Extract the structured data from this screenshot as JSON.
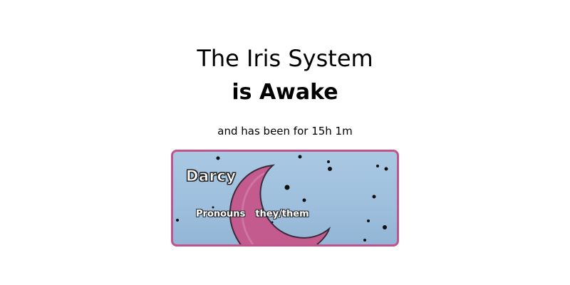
{
  "status": {
    "title_line1": "The Iris System",
    "title_line2": "is Awake",
    "subtitle": "and has been for 15h 1m"
  },
  "member_card": {
    "name": "Darcy",
    "pronouns_label": "Pronouns",
    "pronouns_value": "they/them",
    "colors": {
      "border": "#c0558e",
      "moon": "#c0558e",
      "sky": "#a9c8e2"
    }
  }
}
